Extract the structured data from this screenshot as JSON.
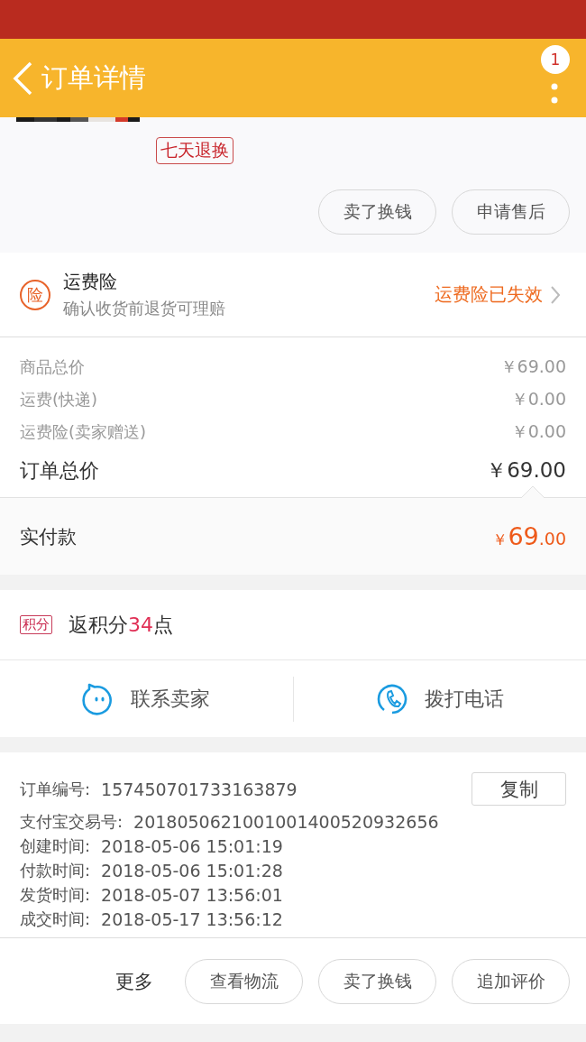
{
  "header": {
    "title": "订单详情",
    "badge": "1"
  },
  "product": {
    "tag": "七天退换",
    "image": {
      "kind": "picture"
    },
    "buttons": [
      "卖了换钱",
      "申请售后"
    ]
  },
  "insurance": {
    "icon_label": "险",
    "title": "运费险",
    "subtitle": "确认收货前退货可理赔",
    "status": "运费险已失效"
  },
  "prices": [
    {
      "label": "商品总价",
      "value": "￥69.00"
    },
    {
      "label": "运费(快递)",
      "value": "￥0.00"
    },
    {
      "label": "运费险(卖家赠送)",
      "value": "￥0.00"
    }
  ],
  "order_total": {
    "label": "订单总价",
    "value": "￥69.00"
  },
  "paid": {
    "label": "实付款",
    "currency": "￥",
    "integer": "69",
    "decimal": ".00"
  },
  "points": {
    "tag": "积分",
    "text": "返积分**34**点"
  },
  "contact": [
    {
      "kind": "chat",
      "label": "联系卖家"
    },
    {
      "kind": "phone",
      "label": "拨打电话"
    }
  ],
  "info": [
    {
      "label": "订单编号:",
      "value": "157450701733163879"
    },
    {
      "label": "支付宝交易号:",
      "value": "2018050621001001400520932656"
    },
    {
      "label": "创建时间:",
      "value": "2018-05-06 15:01:19"
    },
    {
      "label": "付款时间:",
      "value": "2018-05-06 15:01:28"
    },
    {
      "label": "发货时间:",
      "value": "2018-05-07 13:56:01"
    },
    {
      "label": "成交时间:",
      "value": "2018-05-17 13:56:12"
    }
  ],
  "copy_button": "复制",
  "bottom_bar": {
    "more": "更多",
    "buttons": [
      "查看物流",
      "卖了换钱",
      "追加评价"
    ]
  }
}
